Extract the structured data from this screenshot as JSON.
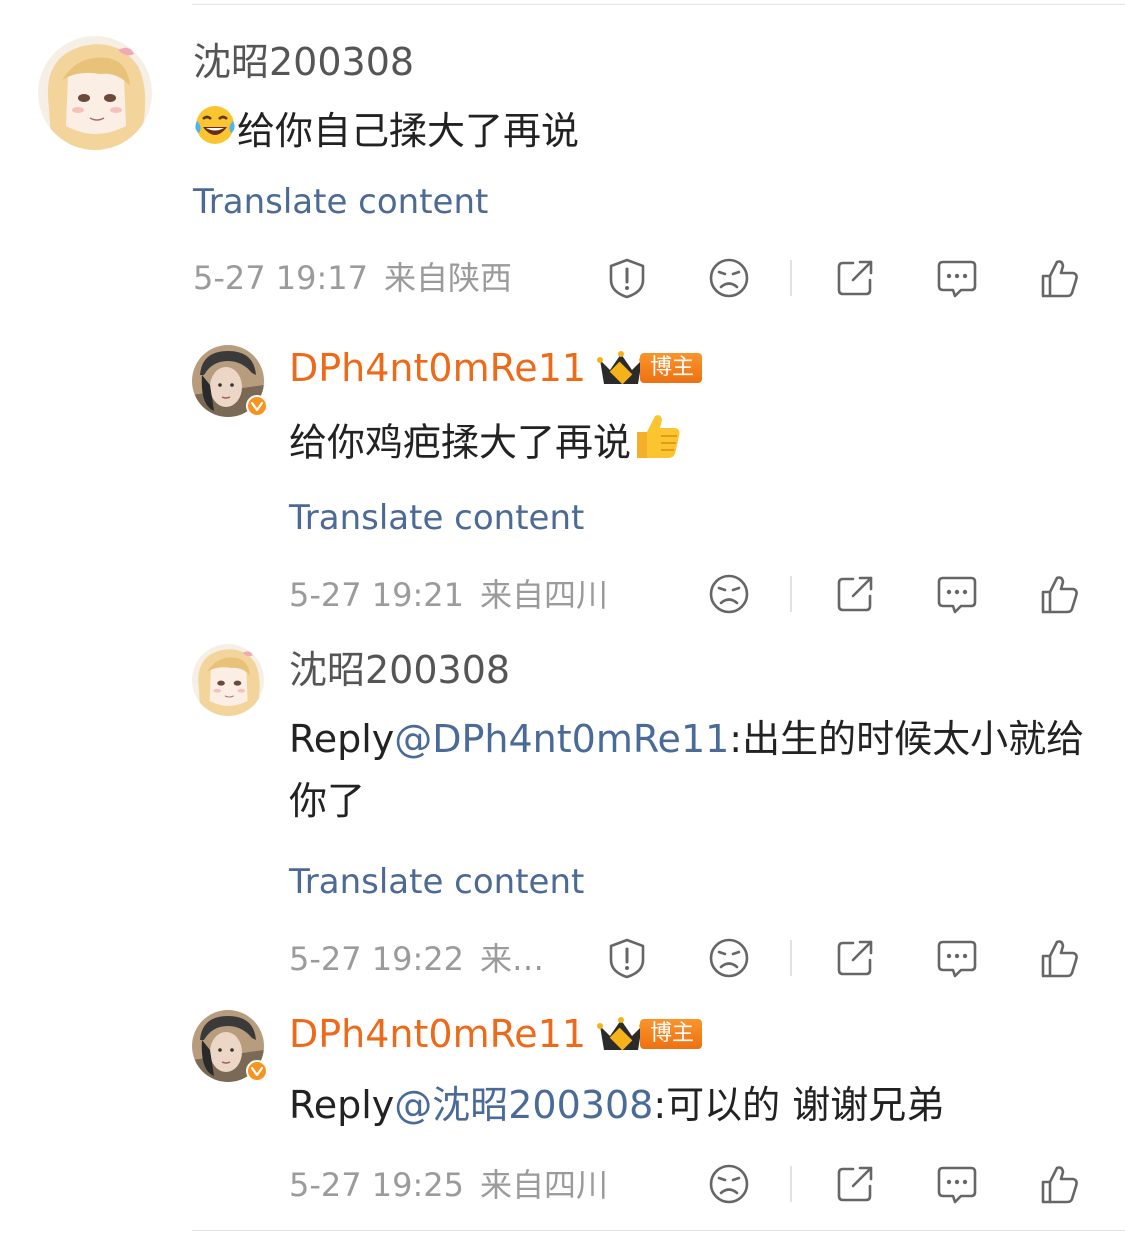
{
  "comments": [
    {
      "username": "沈昭200308",
      "emoji_prefix": "laugh-cry-emoji",
      "content": "给你自己揉大了再说",
      "translate": "Translate content",
      "time": "5-27 19:17",
      "location": "来自陕西"
    },
    {
      "username": "DPh4nt0mRe11",
      "badge": "博主",
      "content": "给你鸡疤揉大了再说",
      "emoji_suffix": "thumbs-up-emoji",
      "translate": "Translate content",
      "time": "5-27 19:21",
      "location": "来自四川"
    },
    {
      "username": "沈昭200308",
      "reply_prefix": "Reply",
      "mention": "@DPh4nt0mRe11",
      "content": ":出生的时候太小就给你了",
      "translate": "Translate content",
      "time": "5-27 19:22",
      "location": "来…"
    },
    {
      "username": "DPh4nt0mRe11",
      "badge": "博主",
      "reply_prefix": "Reply",
      "mention": "@沈昭200308",
      "content": ":可以的 谢谢兄弟",
      "time": "5-27 19:25",
      "location": "来自四川"
    }
  ],
  "colors": {
    "username_gray": "#555555",
    "username_orange": "#ee6a1b",
    "link_blue": "#4c6a95",
    "meta_gray": "#9b9b9b",
    "badge_orange": "#f7931e"
  },
  "icons": [
    "report-icon",
    "dislike-face-icon",
    "share-icon",
    "comment-icon",
    "like-icon",
    "crown-icon",
    "verified-icon"
  ]
}
